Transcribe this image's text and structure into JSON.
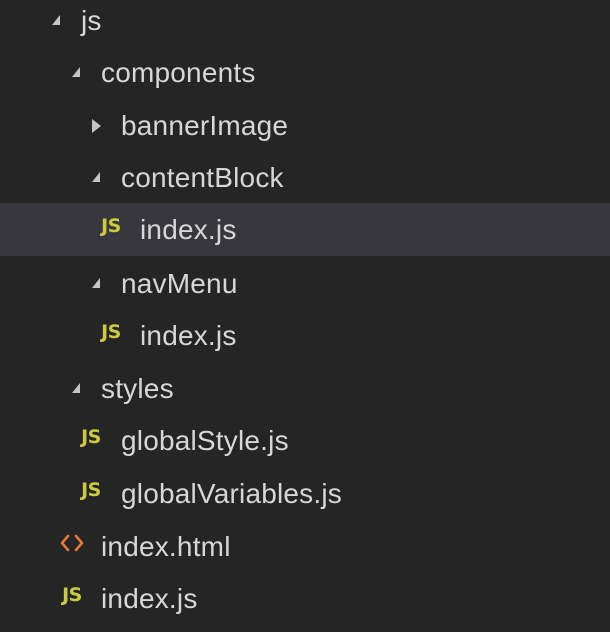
{
  "explorer": {
    "rows": [
      {
        "label": "js",
        "icon": "chevron-down-icon"
      },
      {
        "label": "components",
        "icon": "chevron-down-icon"
      },
      {
        "label": "bannerImage",
        "icon": "chevron-right-icon"
      },
      {
        "label": "contentBlock",
        "icon": "chevron-down-icon"
      },
      {
        "label": "index.js",
        "icon": "js-file-icon",
        "badge": "JS",
        "selected": true
      },
      {
        "label": "navMenu",
        "icon": "chevron-down-icon"
      },
      {
        "label": "index.js",
        "icon": "js-file-icon",
        "badge": "JS"
      },
      {
        "label": "styles",
        "icon": "chevron-down-icon"
      },
      {
        "label": "globalStyle.js",
        "icon": "js-file-icon",
        "badge": "JS"
      },
      {
        "label": "globalVariables.js",
        "icon": "js-file-icon",
        "badge": "JS"
      },
      {
        "label": "index.html",
        "icon": "html-file-icon"
      },
      {
        "label": "index.js",
        "icon": "js-file-icon",
        "badge": "JS"
      }
    ]
  },
  "colors": {
    "background": "#252526",
    "selected_row": "#37373d",
    "js_icon": "#cbcb41",
    "html_icon": "#e37933",
    "text": "#d7d7d7",
    "chevron": "#c5c5c5"
  }
}
